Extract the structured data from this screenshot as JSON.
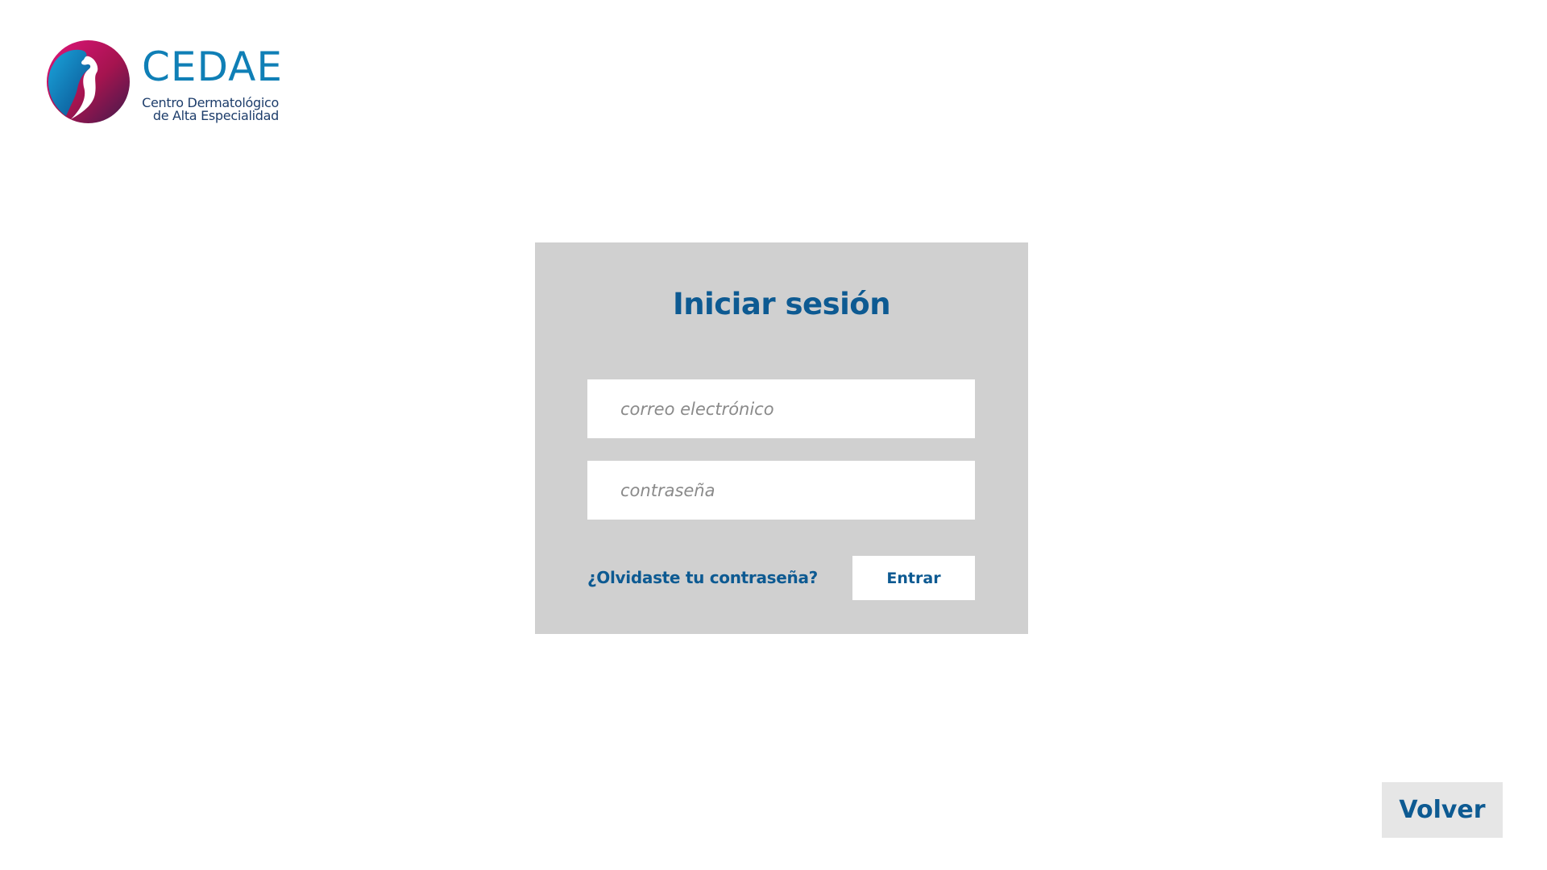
{
  "brand": {
    "name": "CEDAE",
    "tagline_line1": "Centro Dermatológico",
    "tagline_line2": "de Alta Especialidad",
    "colors": {
      "primary": "#0d5a92",
      "wordmark": "#0f7fb6",
      "logo_magenta": "#c4135f",
      "logo_blue": "#0e86c4",
      "logo_purple": "#4a1f5a"
    },
    "logo_icon": "cedae-logo-mark"
  },
  "login": {
    "title": "Iniciar sesión",
    "email_placeholder": "correo electrónico",
    "email_value": "",
    "password_placeholder": "contraseña",
    "password_value": "",
    "forgot_label": "¿Olvidaste tu contraseña?",
    "submit_label": "Entrar",
    "card_color": "#d0d0d0"
  },
  "nav": {
    "back_label": "Volver",
    "back_color": "#e6e6e6"
  }
}
